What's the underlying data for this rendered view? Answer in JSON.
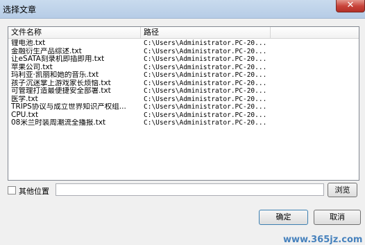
{
  "window": {
    "title": "选择文章",
    "close_glyph": "✕"
  },
  "list": {
    "columns": [
      "文件名称",
      "路径"
    ],
    "rows": [
      {
        "name": "锂电池.txt",
        "path": "C:\\Users\\Administrator.PC-20..."
      },
      {
        "name": "金融衍生产品综述.txt",
        "path": "C:\\Users\\Administrator.PC-20..."
      },
      {
        "name": "让eSATA刻录机即插即用.txt",
        "path": "C:\\Users\\Administrator.PC-20..."
      },
      {
        "name": "苹果公司.txt",
        "path": "C:\\Users\\Administrator.PC-20..."
      },
      {
        "name": "玛利亚·凯丽和她的音乐.txt",
        "path": "C:\\Users\\Administrator.PC-20..."
      },
      {
        "name": "孩子沉迷掌上游戏家长烦恼.txt",
        "path": "C:\\Users\\Administrator.PC-20..."
      },
      {
        "name": "可管理打造最便捷安全部署.txt",
        "path": "C:\\Users\\Administrator.PC-20..."
      },
      {
        "name": "医学.txt",
        "path": "C:\\Users\\Administrator.PC-20..."
      },
      {
        "name": "TRIPS协议与成立世界知识产权组...",
        "path": "C:\\Users\\Administrator.PC-20..."
      },
      {
        "name": "CPU.txt",
        "path": "C:\\Users\\Administrator.PC-20..."
      },
      {
        "name": "08米兰时装周潮流全播报.txt",
        "path": "C:\\Users\\Administrator.PC-20..."
      }
    ]
  },
  "other_location": {
    "label": "其他位置",
    "value": "",
    "checked": false
  },
  "buttons": {
    "browse": "浏览",
    "ok": "确定",
    "cancel": "取消"
  },
  "watermark": "www.365jz.com"
}
